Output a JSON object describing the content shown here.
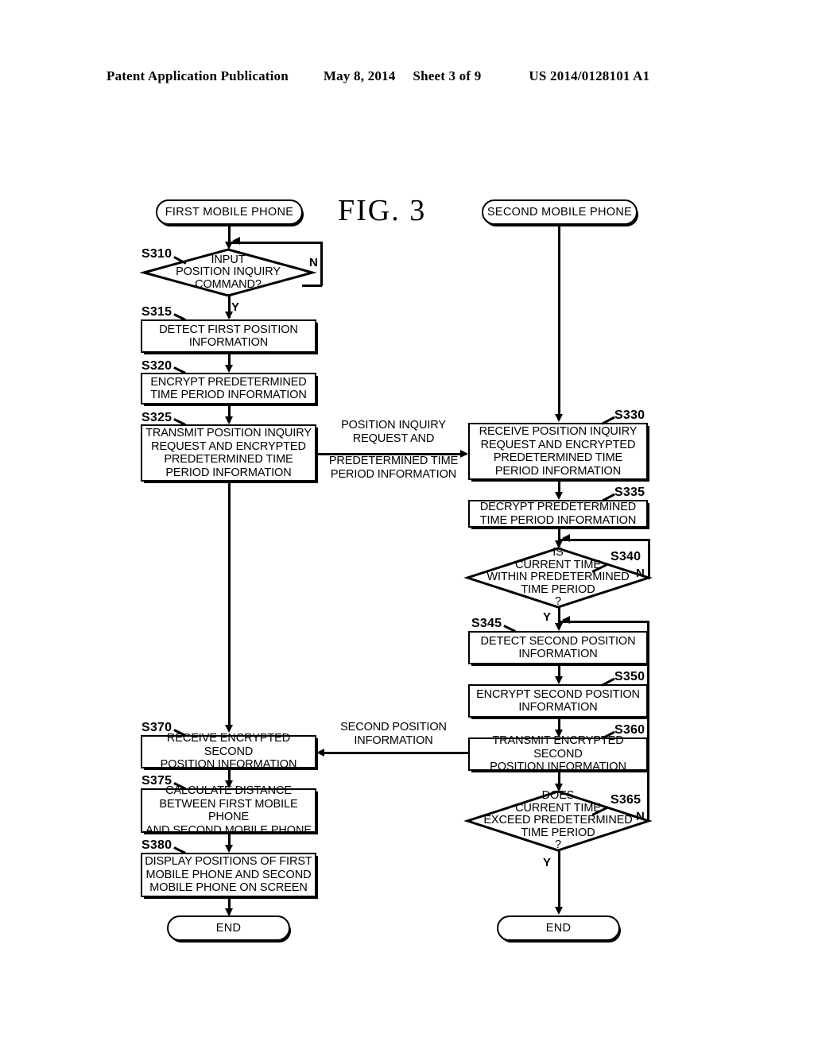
{
  "header": {
    "publication": "Patent Application Publication",
    "date": "May 8, 2014",
    "sheet": "Sheet 3 of 9",
    "number": "US 2014/0128101 A1"
  },
  "figure": {
    "title": "FIG.  3"
  },
  "left_column": {
    "start_terminator": "FIRST MOBILE PHONE",
    "end_terminator": "END",
    "nodes": [
      {
        "id": "S310",
        "label": "S310",
        "type": "decision",
        "text": "INPUT\nPOSITION INQUIRY\nCOMMAND?",
        "lines": [
          "INPUT",
          "POSITION INQUIRY",
          "COMMAND?"
        ],
        "yes": "Y",
        "no": "N"
      },
      {
        "id": "S315",
        "label": "S315",
        "type": "process",
        "lines": [
          "DETECT FIRST POSITION",
          "INFORMATION"
        ]
      },
      {
        "id": "S320",
        "label": "S320",
        "type": "process",
        "lines": [
          "ENCRYPT PREDETERMINED",
          "TIME PERIOD INFORMATION"
        ]
      },
      {
        "id": "S325",
        "label": "S325",
        "type": "process",
        "lines": [
          "TRANSMIT POSITION INQUIRY",
          "REQUEST AND ENCRYPTED",
          "PREDETERMINED TIME",
          "PERIOD INFORMATION"
        ]
      },
      {
        "id": "S370",
        "label": "S370",
        "type": "process",
        "lines": [
          "RECEIVE ENCRYPTED SECOND",
          "POSITION INFORMATION"
        ]
      },
      {
        "id": "S375",
        "label": "S375",
        "type": "process",
        "lines": [
          "CALCULATE DISTANCE",
          "BETWEEN FIRST MOBILE PHONE",
          "AND SECOND MOBILE PHONE"
        ]
      },
      {
        "id": "S380",
        "label": "S380",
        "type": "process",
        "lines": [
          "DISPLAY POSITIONS OF FIRST",
          "MOBILE PHONE AND SECOND",
          "MOBILE PHONE ON SCREEN"
        ]
      }
    ]
  },
  "right_column": {
    "start_terminator": "SECOND MOBILE PHONE",
    "end_terminator": "END",
    "nodes": [
      {
        "id": "S330",
        "label": "S330",
        "type": "process",
        "lines": [
          "RECEIVE POSITION INQUIRY",
          "REQUEST AND ENCRYPTED",
          "PREDETERMINED TIME",
          "PERIOD INFORMATION"
        ]
      },
      {
        "id": "S335",
        "label": "S335",
        "type": "process",
        "lines": [
          "DECRYPT PREDETERMINED",
          "TIME PERIOD INFORMATION"
        ]
      },
      {
        "id": "S340",
        "label": "S340",
        "type": "decision",
        "lines": [
          "IS",
          "CURRENT TIME",
          "WITHIN PREDETERMINED",
          "TIME PERIOD",
          "?"
        ],
        "yes": "Y",
        "no": "N"
      },
      {
        "id": "S345",
        "label": "S345",
        "type": "process",
        "lines": [
          "DETECT SECOND POSITION",
          "INFORMATION"
        ]
      },
      {
        "id": "S350",
        "label": "S350",
        "type": "process",
        "lines": [
          "ENCRYPT SECOND POSITION",
          "INFORMATION"
        ]
      },
      {
        "id": "S360",
        "label": "S360",
        "type": "process",
        "lines": [
          "TRANSMIT ENCRYPTED SECOND",
          "POSITION INFORMATION"
        ]
      },
      {
        "id": "S365",
        "label": "S365",
        "type": "decision",
        "lines": [
          "DOES",
          "CURRENT TIME",
          "EXCEED PREDETERMINED",
          "TIME PERIOD",
          "?"
        ],
        "yes": "Y",
        "no": "N"
      }
    ]
  },
  "inter_column_labels": [
    {
      "id": "request-label",
      "lines_above": [
        "POSITION INQUIRY",
        "REQUEST AND"
      ],
      "lines_below": [
        "PREDETERMINED TIME",
        "PERIOD INFORMATION"
      ],
      "direction": "right"
    },
    {
      "id": "response-label",
      "lines_above": [
        "SECOND POSITION",
        "INFORMATION"
      ],
      "lines_below": [],
      "direction": "left"
    }
  ],
  "colors": {
    "ink": "#000000",
    "paper": "#ffffff"
  }
}
